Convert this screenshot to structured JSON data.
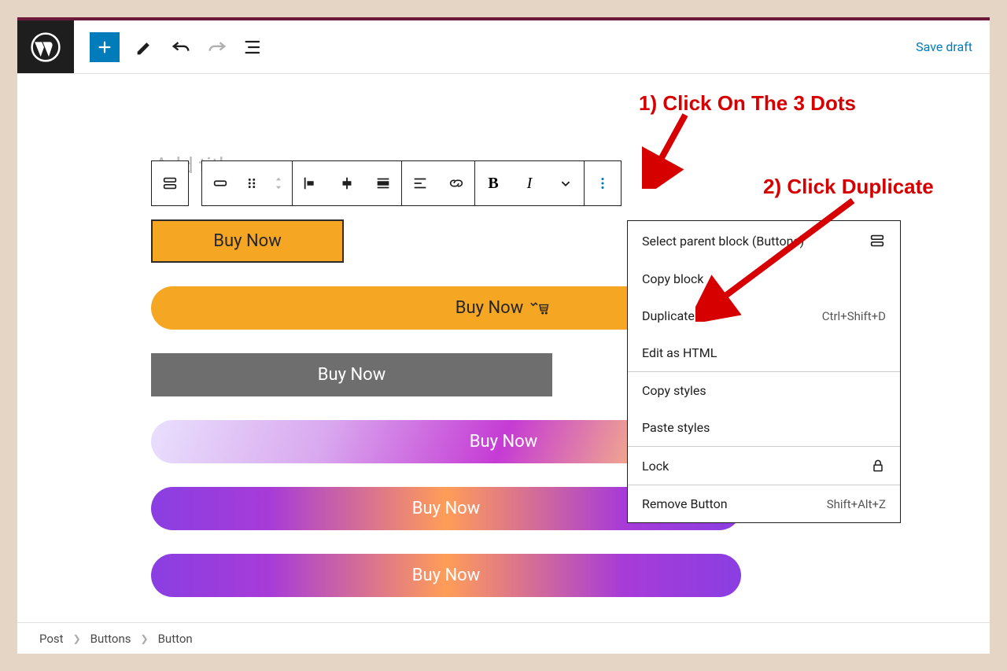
{
  "topbar": {
    "save_draft": "Save draft"
  },
  "buttons": {
    "b1": "Buy Now",
    "b2": "Buy Now",
    "b3": "Buy Now",
    "b4": "Buy Now",
    "b5": "Buy Now",
    "b6": "Buy Now"
  },
  "dropdown": {
    "select_parent": "Select parent block (Buttons)",
    "copy_block": "Copy block",
    "duplicate": "Duplicate",
    "duplicate_shortcut": "Ctrl+Shift+D",
    "edit_html": "Edit as HTML",
    "copy_styles": "Copy styles",
    "paste_styles": "Paste styles",
    "lock": "Lock",
    "remove": "Remove Button",
    "remove_shortcut": "Shift+Alt+Z"
  },
  "annotations": {
    "a1": "1) Click On The 3 Dots",
    "a2": "2) Click Duplicate"
  },
  "breadcrumb": {
    "c1": "Post",
    "c2": "Buttons",
    "c3": "Button"
  },
  "title_placeholder": "Add title"
}
